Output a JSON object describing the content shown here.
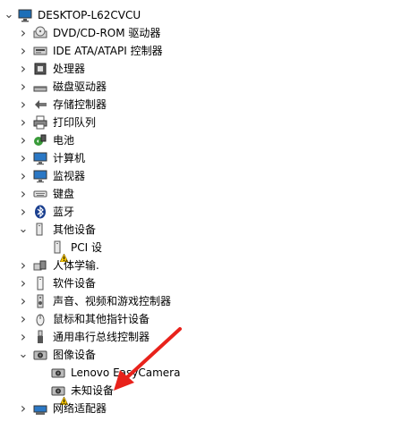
{
  "root": {
    "label": "DESKTOP-L62CVCU",
    "icon": "computer-icon"
  },
  "items": [
    {
      "label": "DVD/CD-ROM 驱动器",
      "icon": "dvd-drive-icon",
      "expanded": false
    },
    {
      "label": "IDE ATA/ATAPI 控制器",
      "icon": "ide-controller-icon",
      "expanded": false
    },
    {
      "label": "处理器",
      "icon": "processor-icon",
      "expanded": false
    },
    {
      "label": "磁盘驱动器",
      "icon": "disk-drive-icon",
      "expanded": false
    },
    {
      "label": "存储控制器",
      "icon": "storage-controller-icon",
      "expanded": false
    },
    {
      "label": "打印队列",
      "icon": "printer-icon",
      "expanded": false
    },
    {
      "label": "电池",
      "icon": "battery-icon",
      "expanded": false
    },
    {
      "label": "计算机",
      "icon": "monitor-icon",
      "expanded": false
    },
    {
      "label": "监视器",
      "icon": "monitor-icon",
      "expanded": false
    },
    {
      "label": "键盘",
      "icon": "keyboard-icon",
      "expanded": false
    },
    {
      "label": "蓝牙",
      "icon": "bluetooth-icon",
      "expanded": false
    },
    {
      "label": "其他设备",
      "icon": "unknown-device-icon",
      "expanded": true,
      "children": [
        {
          "label": "PCI 设",
          "icon": "unknown-device-warning-icon"
        }
      ]
    },
    {
      "label": "人体学输.",
      "icon": "hid-icon",
      "expanded": false
    },
    {
      "label": "软件设备",
      "icon": "software-device-icon",
      "expanded": false
    },
    {
      "label": "声音、视频和游戏控制器",
      "icon": "speaker-icon",
      "expanded": false
    },
    {
      "label": "鼠标和其他指针设备",
      "icon": "mouse-icon",
      "expanded": false
    },
    {
      "label": "通用串行总线控制器",
      "icon": "usb-icon",
      "expanded": false
    },
    {
      "label": "图像设备",
      "icon": "camera-icon",
      "expanded": true,
      "children": [
        {
          "label": "Lenovo EasyCamera",
          "icon": "camera-icon"
        },
        {
          "label": "未知设备",
          "icon": "camera-warning-icon"
        }
      ]
    },
    {
      "label": "网络适配器",
      "icon": "network-adapter-icon",
      "expanded": false
    }
  ],
  "colors": {
    "chevron": "#444444",
    "warning": "#f2c200",
    "arrow": "#e8221b",
    "accent": "#2b78c5"
  }
}
